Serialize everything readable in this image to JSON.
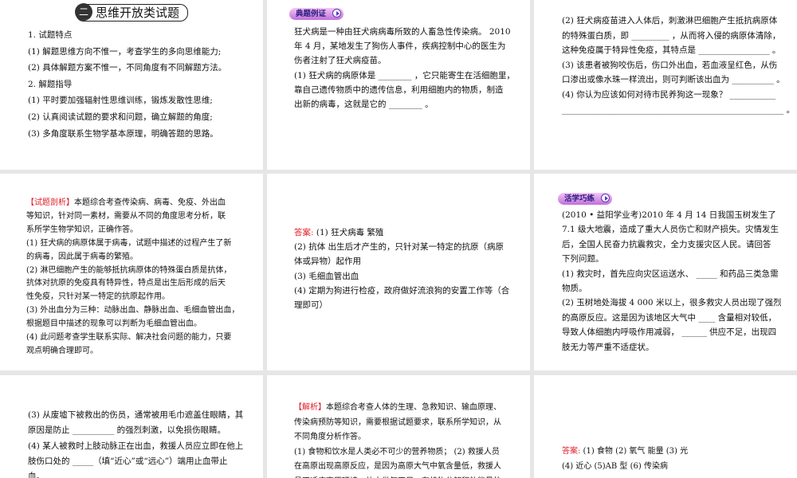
{
  "slides": [
    {
      "title_number": "二",
      "title": "思维开放类试题",
      "lines": [
        "1. 试题特点",
        "(1) 解题思维方向不惟一，考查学生的多向思维能力;",
        "(2) 具体解题方案不惟一，不同角度有不同解题方法。",
        "2. 解题指导",
        "(1) 平时要加强辐射性思维训练，锻炼发散性思维;",
        "(2) 认真阅读试题的要求和问题，确立解题的角度;",
        "(3) 多角度联系生物学基本原理，明确答题的思路。"
      ]
    },
    {
      "badge": "典题例证",
      "lines": [
        "狂犬病是一种由狂犬病病毒所致的人畜急性传染病。 2010",
        "年 4 月，某地发生了狗伤人事件，疾病控制中心的医生为",
        "伤者注射了狂犬病疫苗。",
        "(1) 狂犬病的病原体是 ________ ，它只能寄生在活细胞里，",
        "靠自己遗传物质中的遗传信息，利用细胞内的物质，制造",
        "出新的病毒，这就是它的 ________ 。"
      ]
    },
    {
      "lines": [
        "(2) 狂犬病疫苗进入人体后，刺激淋巴细胞产生抵抗病原体",
        "的特殊蛋白质，即 _________ ，从而将入侵的病原体清除，",
        "这种免疫属于特异性免疫，其特点是 _________________ 。",
        "(3) 该患者被狗咬伤后，伤口外出血，若血液呈红色，从伤",
        "口渗出或像水珠一样流出，则可判断该出血为 __________ 。",
        "(4) 你认为应该如何对待市民养狗这一现象？ ___________",
        "_____________________________________________________ 。"
      ]
    },
    {
      "label": "【试题剖析】",
      "lines": [
        "本题综合考查传染病、病毒、免疫、外出血",
        "等知识，针对同一素材，需要从不同的角度思考分析，联",
        "系所学生物学知识，正确作答。",
        "(1) 狂犬病的病原体属于病毒，试题中描述的过程产生了新",
        "的病毒，因此属于病毒的繁殖。",
        "(2) 淋巴细胞产生的能够抵抗病原体的特殊蛋白质是抗体，",
        "抗体对抗原的免疫具有特异性，特点是出生后形成的后天",
        "性免疫，只针对某一特定的抗原起作用。",
        "(3) 外出血分为三种：动脉出血、静脉出血、毛细血管出血，",
        "根据题目中描述的现象可以判断为毛细血管出血。",
        "(4) 此问题考查学生联系实际、解决社会问题的能力，只要",
        "观点明确合理即可。"
      ]
    },
    {
      "label": "答案:",
      "lines": [
        " (1) 狂犬病毒   繁殖",
        "(2) 抗体   出生后才产生的，只针对某一特定的抗原（病原",
        "体或异物）起作用",
        "(3) 毛细血管出血",
        "(4) 定期为狗进行检疫，政府做好流浪狗的安置工作等（合",
        "理即可）"
      ]
    },
    {
      "badge": "活学巧练",
      "lines": [
        "(2010 • 益阳学业考)2010 年 4 月 14 日我国玉树发生了",
        "7.1 级大地震，造成了重大人员伤亡和财产损失。灾情发生",
        "后，全国人民奋力抗震救灾，全力支援灾区人民。请回答",
        "下列问题。",
        "(1) 救灾时，首先应向灾区运送水、 _____ 和药品三类急需",
        "物质。",
        "(2) 玉树地处海拔 4 000 米以上，很多救灾人员出现了强烈",
        "的高原反应。这是因为该地区大气中 ____ 含量相对较低，",
        "导致人体细胞内呼吸作用减弱， ______ 供应不足，出现四",
        "肢无力等严重不适症状。"
      ]
    },
    {
      "lines": [
        "(3) 从废墟下被救出的伤员，通常被用毛巾遮盖住眼睛，其",
        "原因是防止 __________ 的强烈刺激，以免损伤眼睛。",
        "(4) 某人被救时上肢动脉正在出血，救援人员应立即在他上",
        "肢伤口处的 _____（填“近心”或“远心”）端用止血带止",
        "血。"
      ]
    },
    {
      "label": "【解析】",
      "lines": [
        "本题综合考查人体的生理、急救知识、输血原理、",
        "传染病预防等知识，需要根据试题要求，联系所学知识，从",
        "不同角度分析作答。",
        "(1) 食物和饮水是人类必不可少的营养物质； (2) 救援人员",
        "在高原出现高原反应，是因为高原大气中氧含量低，救援人",
        "员不适应高原环境，体内供氧不足，有机物分解释放能量的"
      ]
    },
    {
      "label": "答案:",
      "lines": [
        " (1) 食物    (2) 氧气   能量    (3) 光",
        "(4) 近心    (5)AB 型    (6) 传染病"
      ]
    }
  ]
}
